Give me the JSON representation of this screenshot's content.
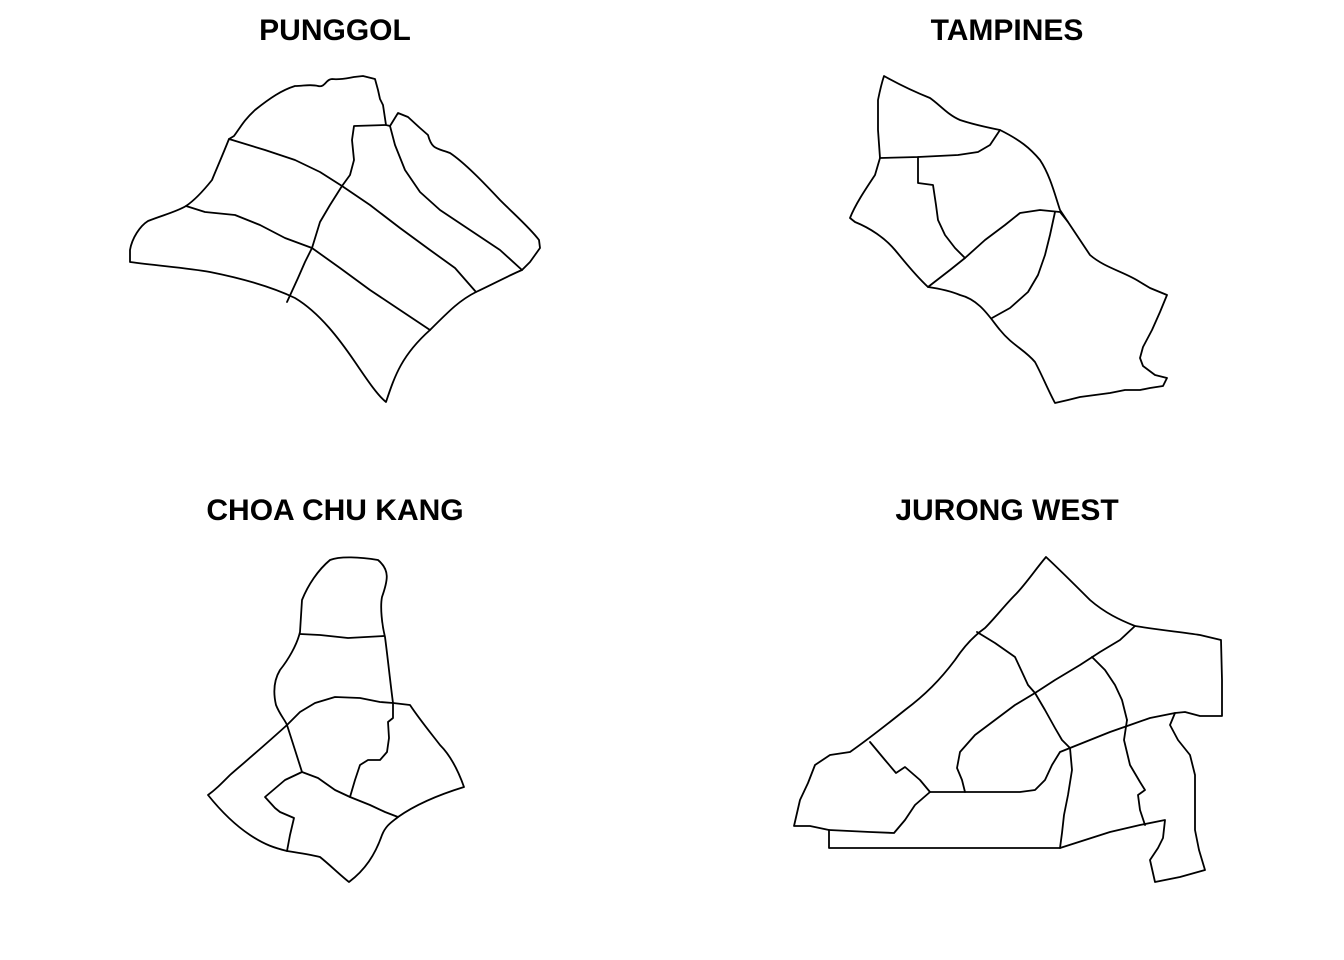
{
  "panels": [
    {
      "title": "PUNGGOL"
    },
    {
      "title": "TAMPINES"
    },
    {
      "title": "CHOA CHU KANG"
    },
    {
      "title": "JURONG WEST"
    }
  ],
  "style": {
    "stroke": "#000000",
    "background": "#ffffff"
  }
}
